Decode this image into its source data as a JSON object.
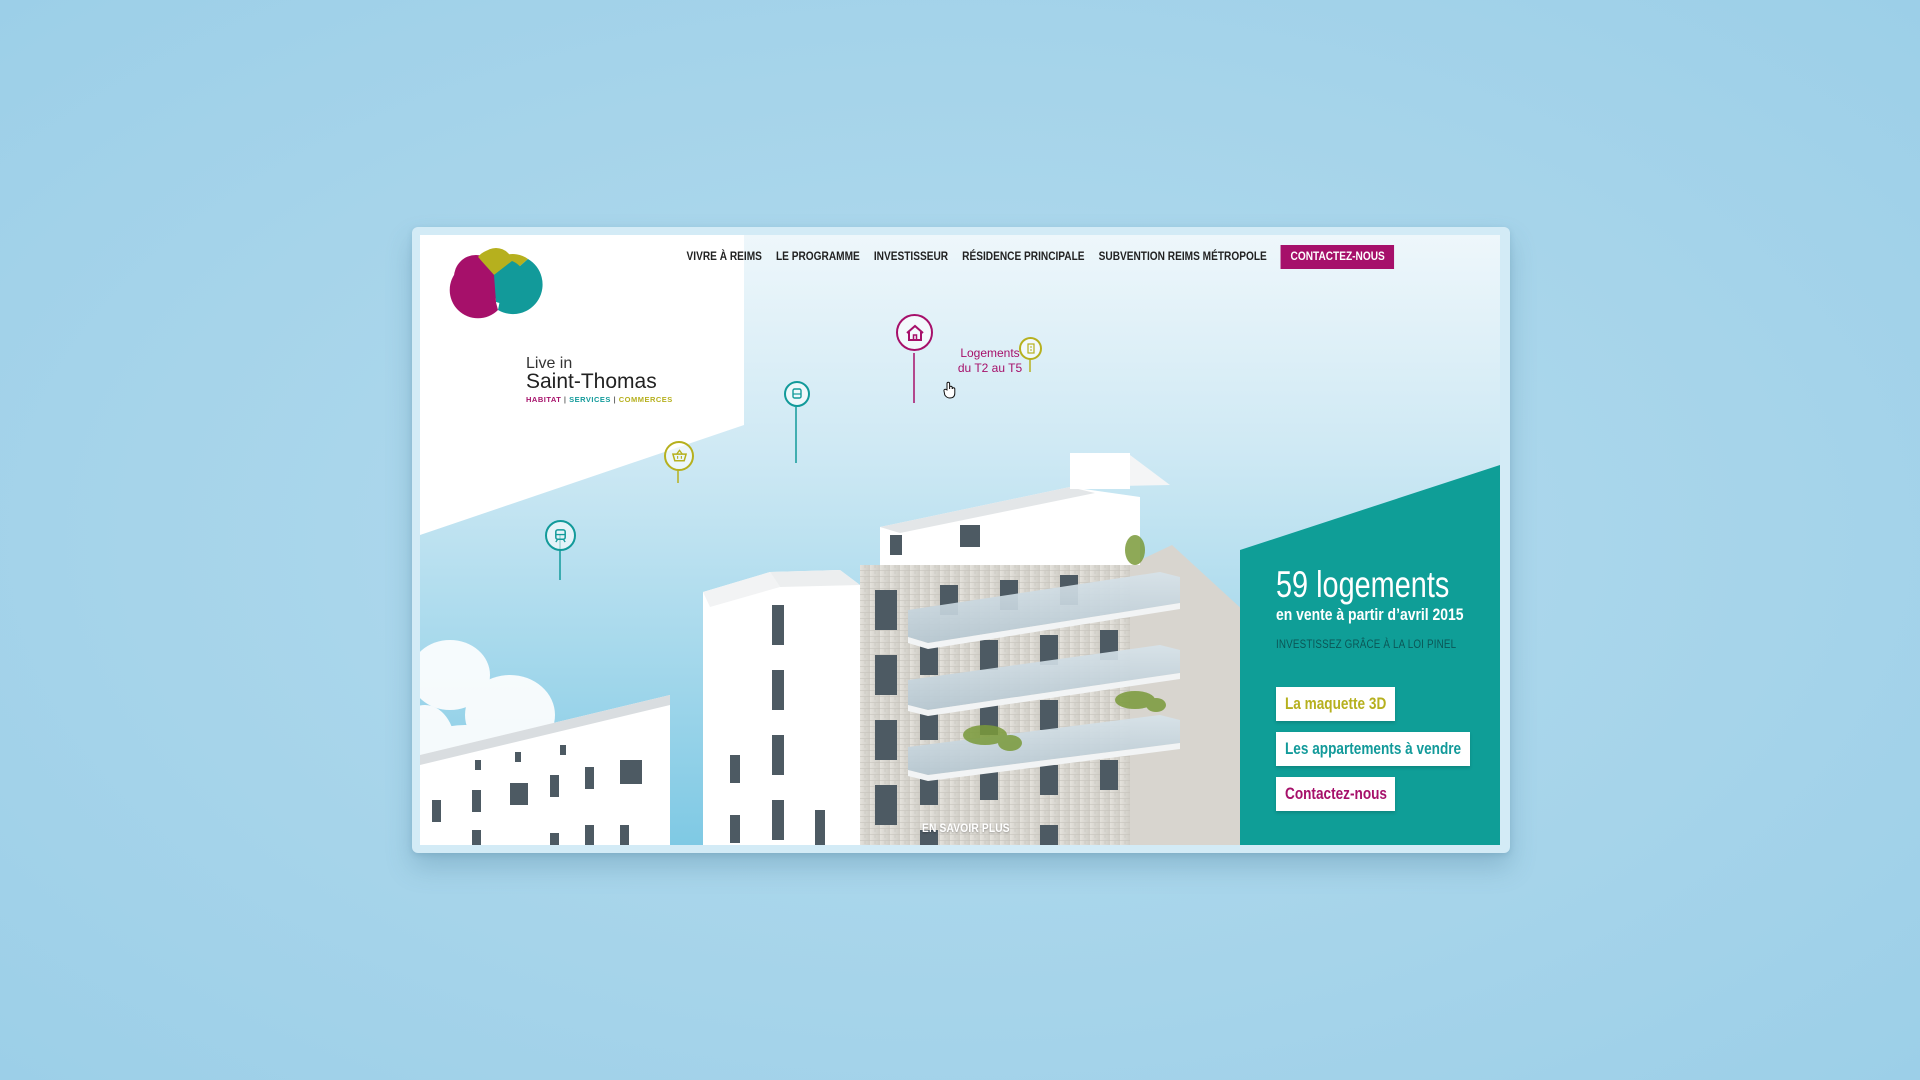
{
  "colors": {
    "brand_magenta": "#a6106a",
    "brand_teal": "#129a9a",
    "brand_olive": "#b6b01e",
    "panel_teal": "#0f9e97",
    "background_blue": "#a6d4ea"
  },
  "nav": {
    "items": [
      "VIVRE À REIMS",
      "LE PROGRAMME",
      "INVESTISSEUR",
      "RÉSIDENCE PRINCIPALE",
      "SUBVENTION REIMS MÉTROPOLE"
    ],
    "cta": "CONTACTEZ-NOUS"
  },
  "logo": {
    "line1": "Live in",
    "line2": "Saint-Thomas",
    "tag_habitat": "HABITAT",
    "tag_services": "SERVICES",
    "tag_commerces": "COMMERCES",
    "separator": "|"
  },
  "pins": {
    "highlight_label_line1": "Logements",
    "highlight_label_line2": "du T2 au T5",
    "icons": [
      "tram-icon",
      "basket-icon",
      "bus-icon",
      "house-icon",
      "building-icon"
    ]
  },
  "panel": {
    "headline": "59 logements",
    "subline": "en vente à partir d’avril 2015",
    "pinel": "INVESTISSEZ GRÂCE À LA LOI PINEL",
    "buttons": [
      "La maquette 3D",
      "Les appartements à vendre",
      "Contactez-nous"
    ]
  },
  "learn_more": "EN SAVOIR PLUS"
}
